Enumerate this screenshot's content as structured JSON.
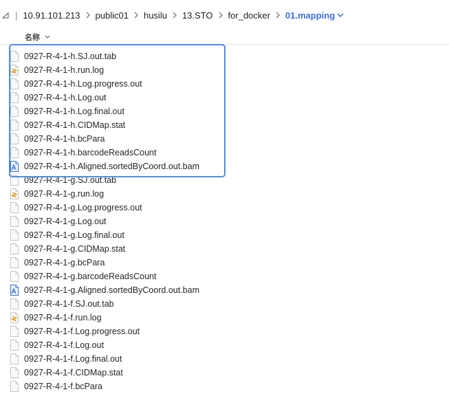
{
  "breadcrumb": {
    "items": [
      "10.91.101.213",
      "public01",
      "husilu",
      "13.STO",
      "for_docker",
      "01.mapping"
    ]
  },
  "column_header": {
    "name_label": "名称"
  },
  "files": [
    {
      "name": "0927-R-4-1-h.SJ.out.tab",
      "icon": "document-icon"
    },
    {
      "name": "0927-R-4-1-h.run.log",
      "icon": "log-file-icon"
    },
    {
      "name": "0927-R-4-1-h.Log.progress.out",
      "icon": "document-icon"
    },
    {
      "name": "0927-R-4-1-h.Log.out",
      "icon": "document-icon"
    },
    {
      "name": "0927-R-4-1-h.Log.final.out",
      "icon": "document-icon"
    },
    {
      "name": "0927-R-4-1-h.CIDMap.stat",
      "icon": "document-icon"
    },
    {
      "name": "0927-R-4-1-h.bcPara",
      "icon": "document-icon"
    },
    {
      "name": "0927-R-4-1-h.barcodeReadsCount",
      "icon": "document-icon"
    },
    {
      "name": "0927-R-4-1-h.Aligned.sortedByCoord.out.bam",
      "icon": "bam-file-icon"
    },
    {
      "name": "0927-R-4-1-g.SJ.out.tab",
      "icon": "document-icon"
    },
    {
      "name": "0927-R-4-1-g.run.log",
      "icon": "log-file-icon"
    },
    {
      "name": "0927-R-4-1-g.Log.progress.out",
      "icon": "document-icon"
    },
    {
      "name": "0927-R-4-1-g.Log.out",
      "icon": "document-icon"
    },
    {
      "name": "0927-R-4-1-g.Log.final.out",
      "icon": "document-icon"
    },
    {
      "name": "0927-R-4-1-g.CIDMap.stat",
      "icon": "document-icon"
    },
    {
      "name": "0927-R-4-1-g.bcPara",
      "icon": "document-icon"
    },
    {
      "name": "0927-R-4-1-g.barcodeReadsCount",
      "icon": "document-icon"
    },
    {
      "name": "0927-R-4-1-g.Aligned.sortedByCoord.out.bam",
      "icon": "bam-file-icon"
    },
    {
      "name": "0927-R-4-1-f.SJ.out.tab",
      "icon": "document-icon"
    },
    {
      "name": "0927-R-4-1-f.run.log",
      "icon": "log-file-icon"
    },
    {
      "name": "0927-R-4-1-f.Log.progress.out",
      "icon": "document-icon"
    },
    {
      "name": "0927-R-4-1-f.Log.out",
      "icon": "document-icon"
    },
    {
      "name": "0927-R-4-1-f.Log.final.out",
      "icon": "document-icon"
    },
    {
      "name": "0927-R-4-1-f.CIDMap.stat",
      "icon": "document-icon"
    },
    {
      "name": "0927-R-4-1-f.bcPara",
      "icon": "document-icon"
    }
  ],
  "colors": {
    "accent": "#3a6ee0",
    "selection_border": "#4a8ee8",
    "log_icon": "#e59b1e",
    "bam_icon": "#3b6fd6"
  }
}
